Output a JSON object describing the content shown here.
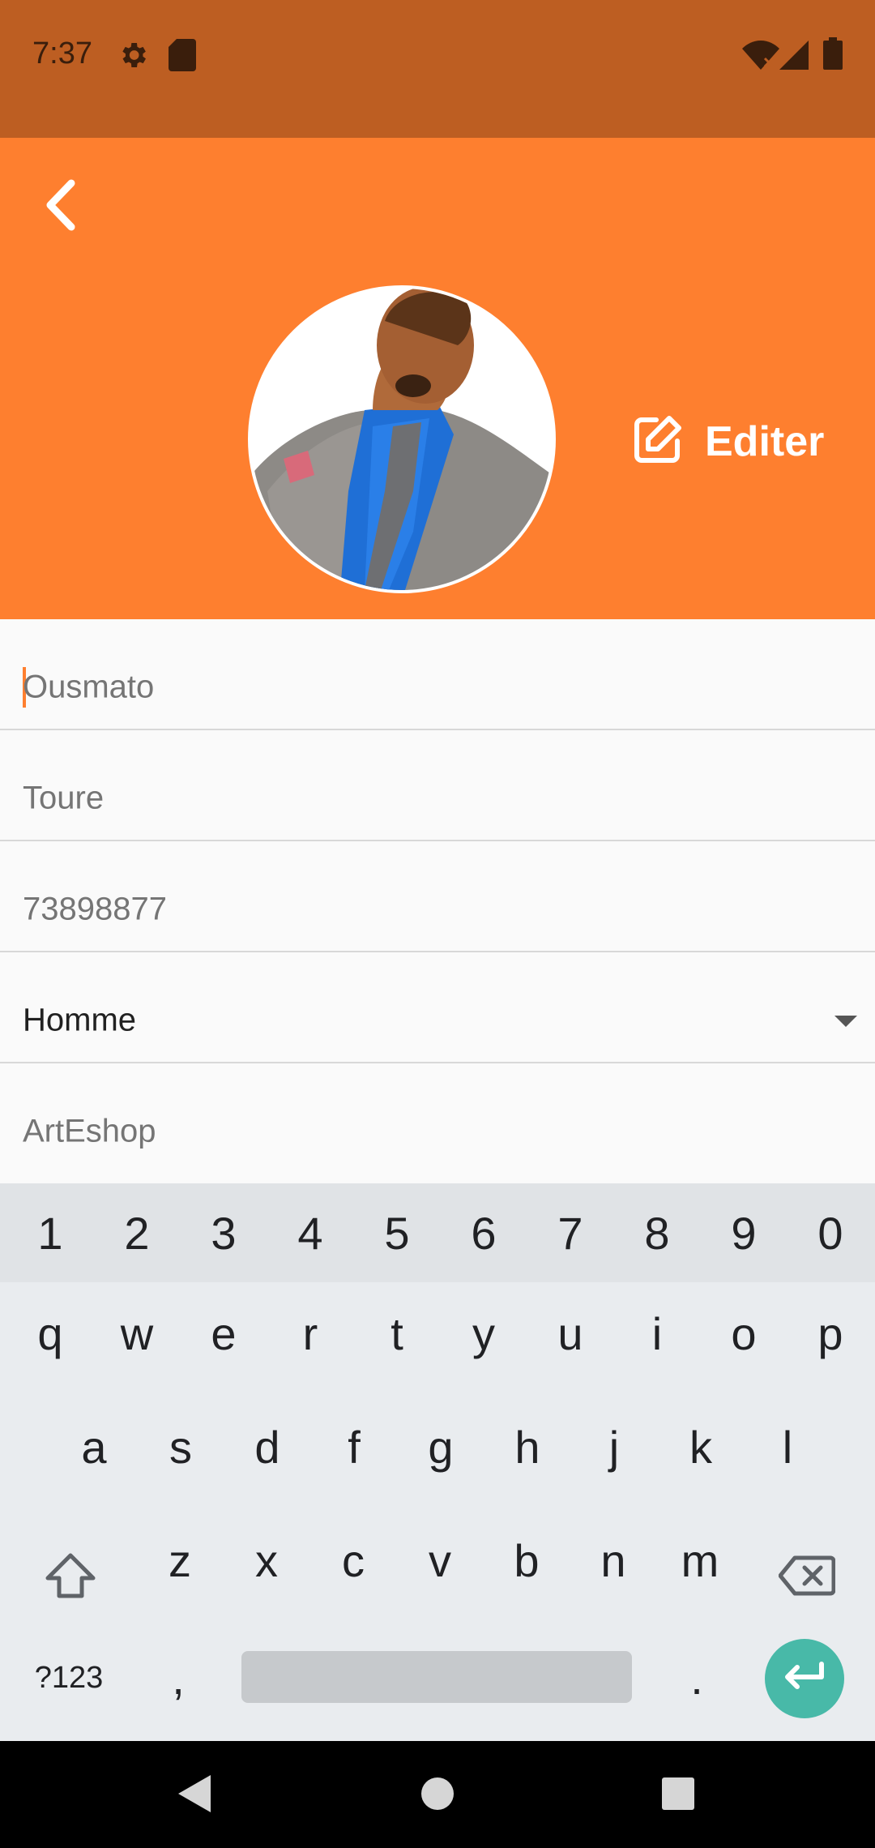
{
  "status_bar": {
    "time": "7:37",
    "icons": [
      "gear-icon",
      "sd-card-icon",
      "wifi-off-icon",
      "signal-icon",
      "battery-icon"
    ]
  },
  "header": {
    "back_icon": "chevron-left-icon",
    "edit_label": "Editer",
    "edit_icon": "edit-icon"
  },
  "form": {
    "first_name": "Ousmato",
    "last_name": "Toure",
    "phone": "73898877",
    "gender": "Homme",
    "shop": "ArtEshop"
  },
  "keyboard": {
    "number_row": [
      "1",
      "2",
      "3",
      "4",
      "5",
      "6",
      "7",
      "8",
      "9",
      "0"
    ],
    "row1": [
      "q",
      "w",
      "e",
      "r",
      "t",
      "y",
      "u",
      "i",
      "o",
      "p"
    ],
    "row2": [
      "a",
      "s",
      "d",
      "f",
      "g",
      "h",
      "j",
      "k",
      "l"
    ],
    "row3": [
      "z",
      "x",
      "c",
      "v",
      "b",
      "n",
      "m"
    ],
    "symbols_label": "?123",
    "comma": ",",
    "period": "."
  },
  "colors": {
    "status_bar": "#bd5e22",
    "header": "#fe7f2f",
    "enter_key": "#48b9a8"
  }
}
